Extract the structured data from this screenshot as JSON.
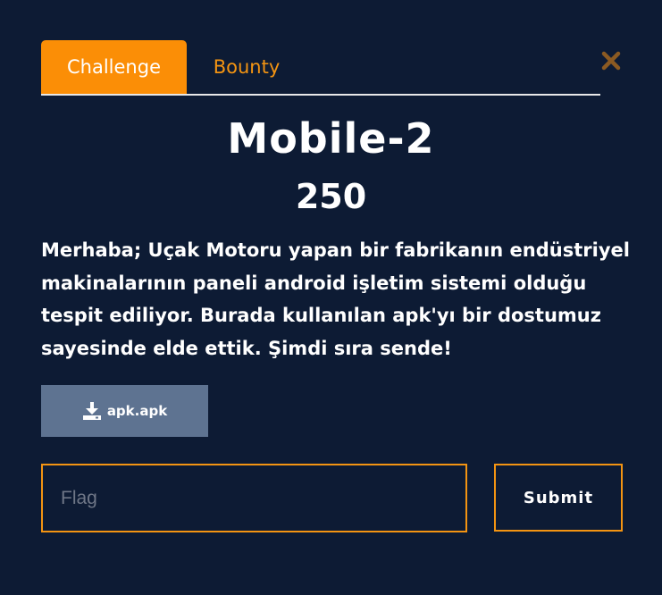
{
  "tabs": [
    {
      "label": "Challenge",
      "active": true
    },
    {
      "label": "Bounty",
      "active": false
    }
  ],
  "close_icon": "close-icon",
  "challenge": {
    "title": "Mobile-2",
    "points": "250",
    "description": "Merhaba; Uçak Motoru yapan bir fabrikanın endüstriyel makinalarının paneli android işletim sistemi olduğu tespit ediliyor. Burada kullanılan apk'yı bir dostumuz sayesinde elde ettik. Şimdi sıra sende!"
  },
  "attachment": {
    "label": "apk.apk",
    "icon": "download-icon"
  },
  "flag_form": {
    "placeholder": "Flag",
    "value": "",
    "submit_label": "Submit"
  },
  "colors": {
    "background": "#0d1b34",
    "accent": "#fb8e06",
    "tab_inactive_text": "#f39412",
    "download_button": "#5e7391",
    "close_icon": "#8b5a22"
  }
}
